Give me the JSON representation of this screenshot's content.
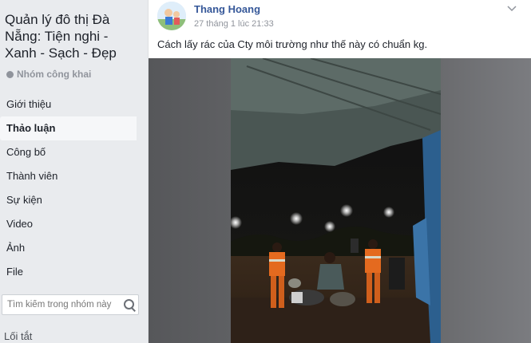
{
  "sidebar": {
    "group_title": "Quản lý đô thị Đà Nẵng: Tiện nghi - Xanh - Sạch - Đẹp",
    "privacy": "Nhóm công khai",
    "items": [
      {
        "label": "Giới thiệu"
      },
      {
        "label": "Thảo luận"
      },
      {
        "label": "Công bố"
      },
      {
        "label": "Thành viên"
      },
      {
        "label": "Sự kiện"
      },
      {
        "label": "Video"
      },
      {
        "label": "Ảnh"
      },
      {
        "label": "File"
      }
    ],
    "active_item": "Thảo luận",
    "search": {
      "placeholder": "Tìm kiếm trong nhóm này"
    },
    "shortcuts_label": "Lối tắt"
  },
  "post": {
    "author": "Thang Hoang",
    "timestamp": "27 tháng 1 lúc 21:33",
    "text": "Cách lấy rác của Cty môi trường như thế này có chuẩn kg."
  },
  "colors": {
    "link_blue": "#365899",
    "page_bg": "#e9ebee",
    "safety_orange": "#e46a1f"
  }
}
